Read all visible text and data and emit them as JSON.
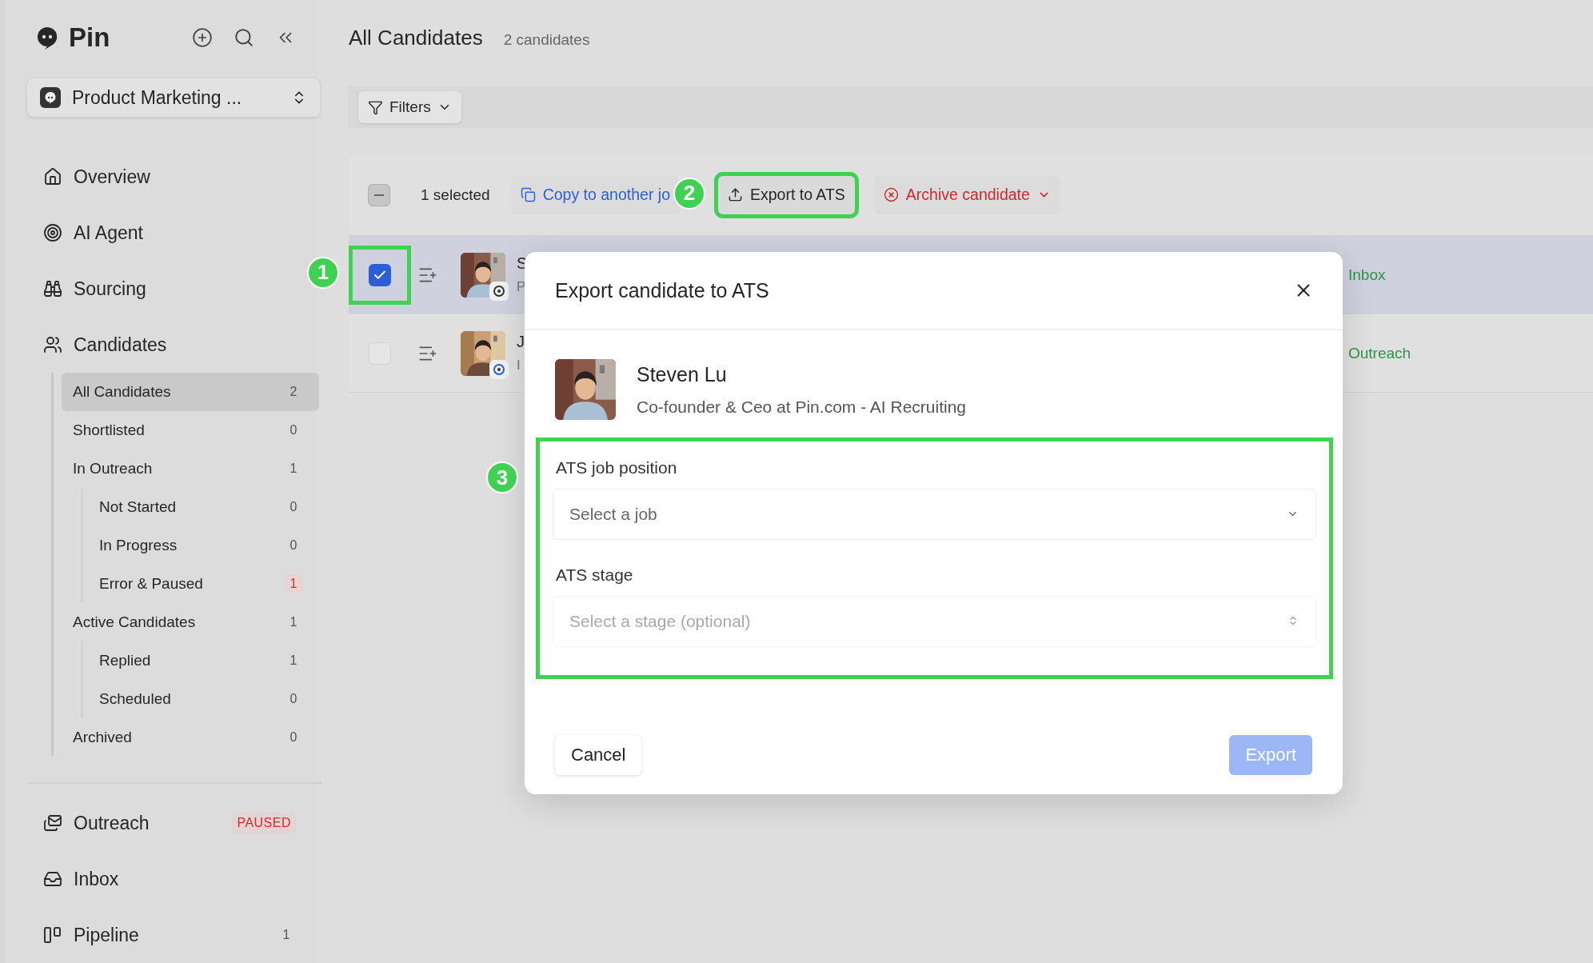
{
  "app": {
    "logo": "Pin"
  },
  "workspace": {
    "name": "Product Marketing ..."
  },
  "nav": [
    {
      "label": "Overview",
      "selected": false
    },
    {
      "label": "AI Agent",
      "selected": false
    },
    {
      "label": "Sourcing",
      "selected": false
    },
    {
      "label": "Candidates",
      "selected": false,
      "children": [
        {
          "label": "All Candidates",
          "count": "2",
          "selected": true,
          "alert": false
        },
        {
          "label": "Shortlisted",
          "count": "0",
          "selected": false,
          "alert": false
        },
        {
          "label": "In Outreach",
          "count": "1",
          "selected": false,
          "alert": false,
          "children": [
            {
              "label": "Not Started",
              "count": "0",
              "selected": false,
              "alert": false
            },
            {
              "label": "In Progress",
              "count": "0",
              "selected": false,
              "alert": false
            },
            {
              "label": "Error & Paused",
              "count": "1",
              "selected": false,
              "alert": true
            }
          ]
        },
        {
          "label": "Active Candidates",
          "count": "1",
          "selected": false,
          "alert": false,
          "children": [
            {
              "label": "Replied",
              "count": "1",
              "selected": false,
              "alert": false
            },
            {
              "label": "Scheduled",
              "count": "0",
              "selected": false,
              "alert": false
            }
          ]
        },
        {
          "label": "Archived",
          "count": "0",
          "selected": false,
          "alert": false
        }
      ]
    }
  ],
  "nav_bottom": [
    {
      "label": "Outreach",
      "badge": "PAUSED"
    },
    {
      "label": "Inbox"
    },
    {
      "label": "Pipeline",
      "count": "1"
    }
  ],
  "page": {
    "title": "All Candidates",
    "count": "2 candidates"
  },
  "filters": {
    "label": "Filters"
  },
  "toolbar": {
    "indeterminate": true,
    "selected_count": "1 selected",
    "actions": [
      {
        "kind": "copy",
        "label": "Copy to another jo"
      },
      {
        "kind": "export",
        "label": "Export to ATS",
        "marker": "2"
      },
      {
        "kind": "archive",
        "label": "Archive candidate"
      }
    ]
  },
  "rows": [
    {
      "selected": true,
      "checked": true,
      "name": "S",
      "subtitle": "P",
      "status": "Inbox",
      "marker": "1"
    },
    {
      "selected": false,
      "checked": false,
      "name": "J",
      "subtitle": "I",
      "status": "Outreach"
    }
  ],
  "modal": {
    "title": "Export candidate to ATS",
    "candidate": {
      "name": "Steven Lu",
      "headline": "Co-founder & Ceo at Pin.com - AI Recruiting"
    },
    "marker": "3",
    "fields": [
      {
        "label": "ATS job position",
        "placeholder": "Select a job",
        "kind": "dropdown",
        "disabled": false
      },
      {
        "label": "ATS stage",
        "placeholder": "Select a stage (optional)",
        "kind": "updown",
        "disabled": true
      }
    ],
    "buttons": [
      {
        "label": "Cancel",
        "kind": "secondary",
        "disabled": false
      },
      {
        "label": "Export",
        "kind": "primary",
        "disabled": true
      }
    ]
  }
}
